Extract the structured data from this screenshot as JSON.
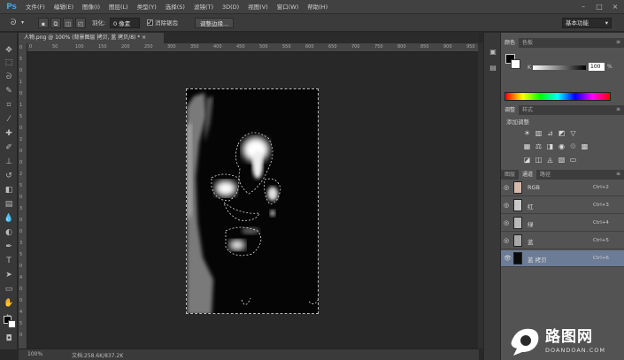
{
  "app": {
    "logo": "Ps"
  },
  "menu": [
    "文件(F)",
    "编辑(E)",
    "图像(I)",
    "图层(L)",
    "类型(Y)",
    "选择(S)",
    "滤镜(T)",
    "3D(D)",
    "视图(V)",
    "窗口(W)",
    "帮助(H)"
  ],
  "options": {
    "feather_label": "羽化:",
    "feather_value": "0 像素",
    "antialias_label": "消除锯齿",
    "refine_edge": "调整边缘...",
    "workspace": "基本功能"
  },
  "document": {
    "tab_title": "人物.png @ 100% (背景图层 拷贝, 蓝 拷贝/8) * ×",
    "zoom": "100%",
    "doc_size": "文档:258.6K/837.2K"
  },
  "ruler": {
    "top": [
      "0",
      "50",
      "100",
      "150",
      "200",
      "250",
      "300",
      "350",
      "400",
      "450",
      "500",
      "550",
      "600",
      "650",
      "700",
      "750",
      "800",
      "850",
      "900",
      "950"
    ],
    "left": [
      "0",
      "5",
      "0",
      "1",
      "0",
      "1",
      "5",
      "0",
      "2",
      "0",
      "0",
      "2",
      "5",
      "0",
      "3",
      "0",
      "0",
      "3",
      "5",
      "0",
      "4",
      "0",
      "0",
      "4",
      "5",
      "0"
    ]
  },
  "panels": {
    "color_tabs": [
      "颜色",
      "色板"
    ],
    "color_k_label": "K",
    "color_k_value": "100",
    "color_k_pct": "%",
    "adjust_tabs": [
      "调整",
      "样式"
    ],
    "adjust_title": "添加调整",
    "layer_tabs": [
      "图层",
      "通道",
      "路径"
    ]
  },
  "channels": [
    {
      "name": "RGB",
      "shortcut": "Ctrl+2",
      "thumb": "#d8b8a8",
      "eye": "◎",
      "active": false
    },
    {
      "name": "红",
      "shortcut": "Ctrl+3",
      "thumb": "#c8c8c8",
      "eye": "◎",
      "active": false
    },
    {
      "name": "绿",
      "shortcut": "Ctrl+4",
      "thumb": "#b8b8b8",
      "eye": "◎",
      "active": false
    },
    {
      "name": "蓝",
      "shortcut": "Ctrl+5",
      "thumb": "#a8a8a8",
      "eye": "◎",
      "active": false
    },
    {
      "name": "蓝 拷贝",
      "shortcut": "Ctrl+6",
      "thumb": "#0a0a0a",
      "eye": "👁",
      "active": true
    }
  ],
  "watermark": {
    "text": "路图网",
    "url": "DOANDOAN.COM"
  },
  "icons": {
    "tools": [
      "move-icon",
      "marquee-icon",
      "lasso-icon",
      "quick-select-icon",
      "crop-icon",
      "eyedropper-icon",
      "healing-brush-icon",
      "brush-icon",
      "clone-stamp-icon",
      "history-brush-icon",
      "eraser-icon",
      "gradient-icon",
      "blur-icon",
      "dodge-icon",
      "pen-icon",
      "type-icon",
      "path-select-icon",
      "rectangle-icon",
      "hand-icon",
      "zoom-icon"
    ],
    "adjustments": [
      "brightness-contrast-icon",
      "levels-icon",
      "curves-icon",
      "exposure-icon",
      "vibrance-icon",
      "hue-saturation-icon",
      "color-balance-icon",
      "black-white-icon",
      "photo-filter-icon",
      "channel-mixer-icon",
      "color-lookup-icon",
      "invert-icon",
      "posterize-icon",
      "threshold-icon",
      "selective-color-icon",
      "gradient-map-icon"
    ]
  }
}
